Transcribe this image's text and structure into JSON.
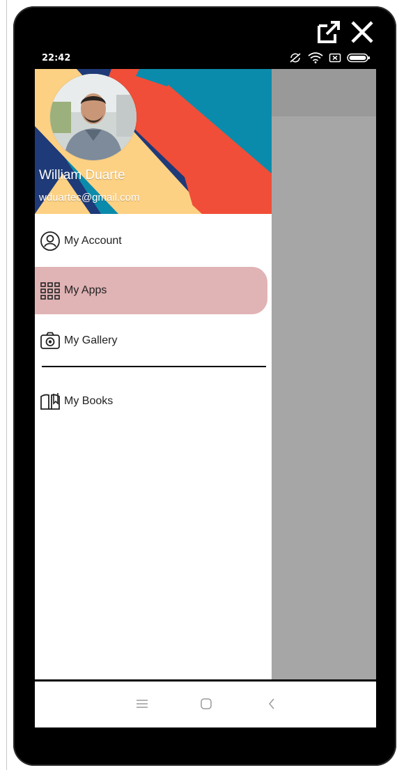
{
  "window": {
    "open_external_icon": "open-external-icon",
    "close_icon": "close-icon"
  },
  "status_bar": {
    "time": "22:42",
    "icons": [
      "rotate-off-icon",
      "wifi-icon",
      "sim-icon",
      "battery-icon"
    ]
  },
  "drawer": {
    "header": {
      "name": "William Duarte",
      "email": "wduartec@gmail.com",
      "colors": {
        "blue": "#0b8bab",
        "red": "#f04e38",
        "navy": "#1e3a78",
        "yellow": "#fdd183"
      }
    },
    "items": [
      {
        "label": "My Account",
        "icon": "account-circle-icon",
        "selected": false
      },
      {
        "label": "My Apps",
        "icon": "apps-grid-icon",
        "selected": true
      },
      {
        "label": "My Gallery",
        "icon": "camera-icon",
        "selected": false
      },
      {
        "label": "My Books",
        "icon": "book-icon",
        "selected": false
      }
    ],
    "selected_color": "#e0b3b5"
  },
  "nav_bar": {
    "buttons": [
      "menu-icon",
      "home-icon",
      "back-icon"
    ]
  }
}
